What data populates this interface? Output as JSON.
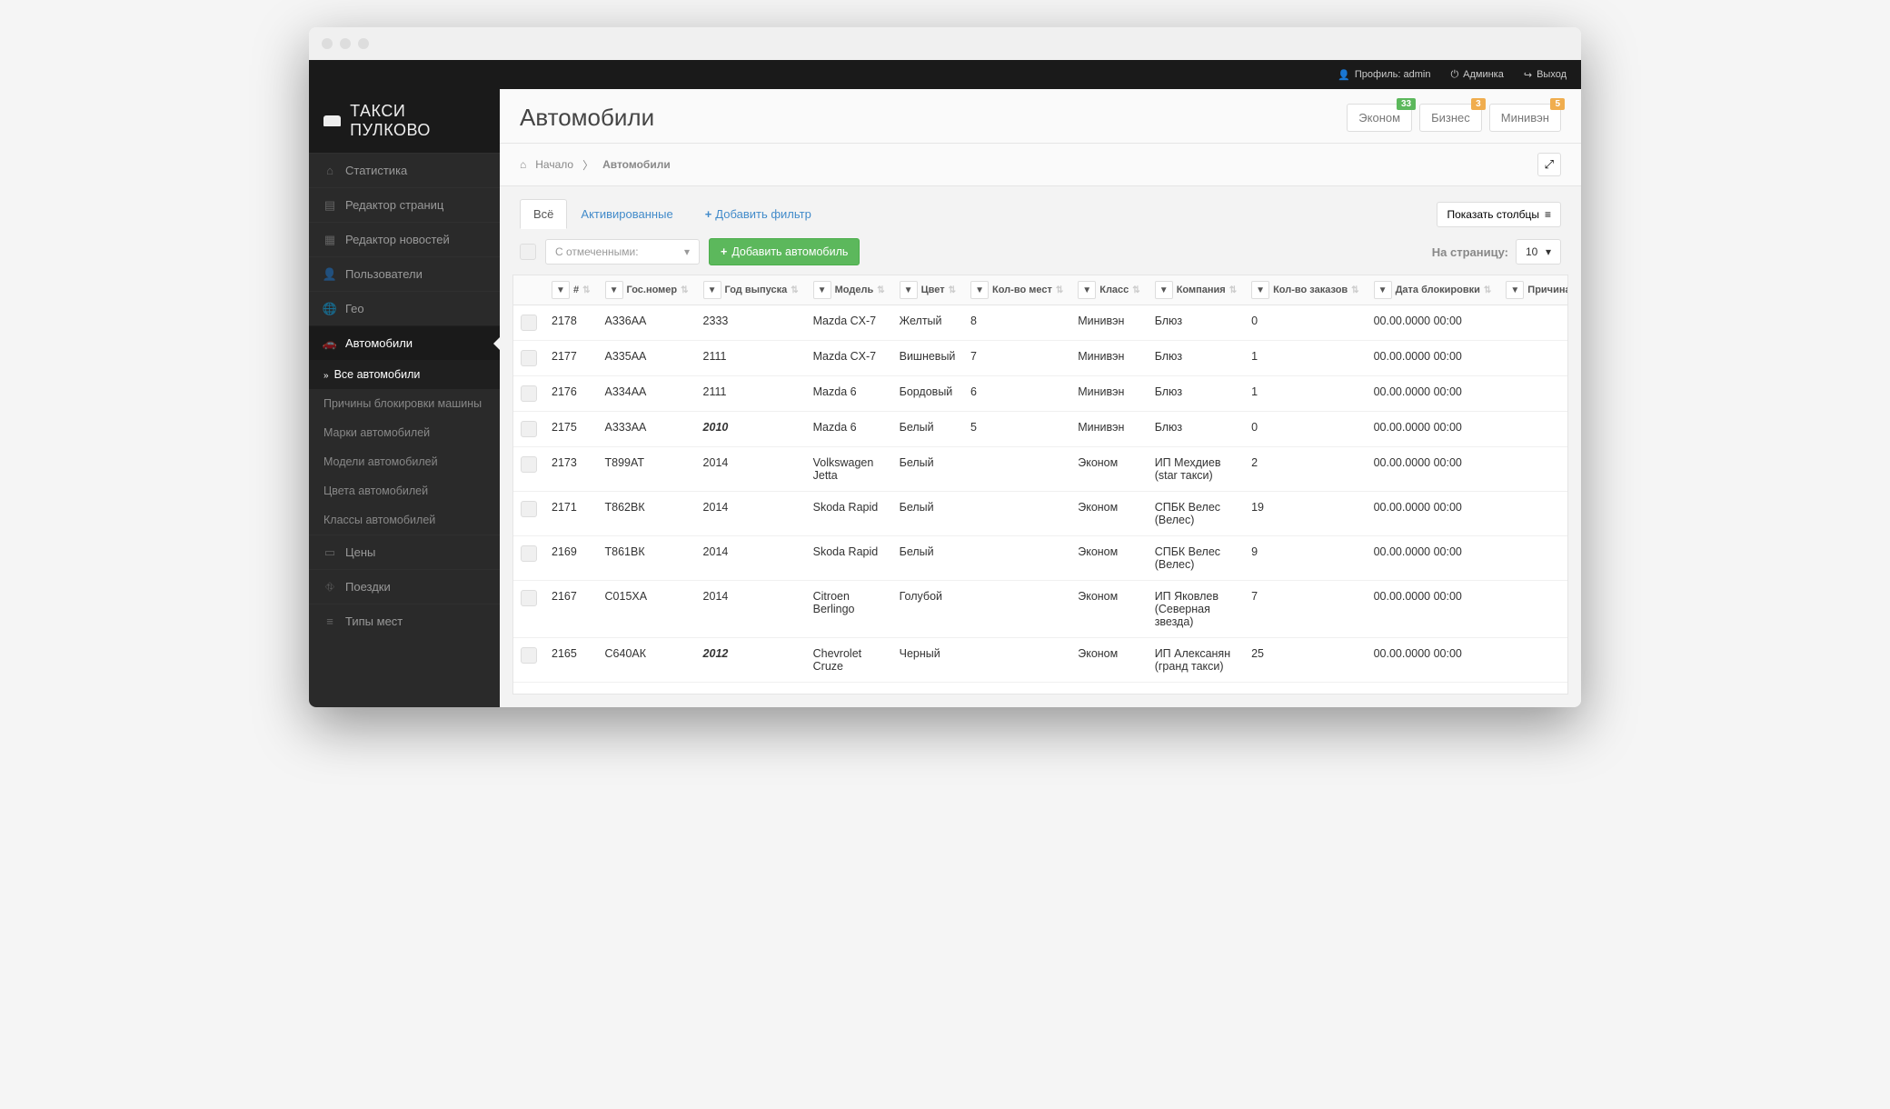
{
  "topbar": {
    "profile": "Профиль: admin",
    "admin": "Админка",
    "logout": "Выход"
  },
  "brand": "ТАКСИ ПУЛКОВО",
  "sidebar": {
    "items": [
      {
        "label": "Статистика"
      },
      {
        "label": "Редактор страниц"
      },
      {
        "label": "Редактор новостей"
      },
      {
        "label": "Пользователи"
      },
      {
        "label": "Гео"
      },
      {
        "label": "Автомобили"
      },
      {
        "label": "Цены"
      },
      {
        "label": "Поездки"
      },
      {
        "label": "Типы мест"
      }
    ],
    "sub": [
      {
        "label": "Все автомобили"
      },
      {
        "label": "Причины блокировки машины"
      },
      {
        "label": "Марки автомобилей"
      },
      {
        "label": "Модели автомобилей"
      },
      {
        "label": "Цвета автомобилей"
      },
      {
        "label": "Классы автомобилей"
      }
    ]
  },
  "header": {
    "title": "Автомобили",
    "badges": [
      {
        "label": "Эконом",
        "count": "33",
        "color": "green"
      },
      {
        "label": "Бизнес",
        "count": "3",
        "color": "orange"
      },
      {
        "label": "Минивэн",
        "count": "5",
        "color": "orange"
      }
    ]
  },
  "breadcrumb": {
    "home": "Начало",
    "current": "Автомобили"
  },
  "tabs": {
    "all": "Всё",
    "activated": "Активированные"
  },
  "add_filter": "Добавить фильтр",
  "show_columns": "Показать столбцы",
  "bulk_placeholder": "С отмеченными:",
  "add_car": "Добавить автомобиль",
  "per_page_label": "На страницу:",
  "per_page_value": "10",
  "columns": [
    "#",
    "Гос.номер",
    "Год выпуска",
    "Модель",
    "Цвет",
    "Кол-во мест",
    "Класс",
    "Компания",
    "Кол-во заказов",
    "Дата блокировки",
    "Причина блокировки"
  ],
  "rows": [
    {
      "id": "2178",
      "plate": "А336АА",
      "year": "2333",
      "model": "Mazda CX-7",
      "color": "Желтый",
      "seats": "8",
      "class": "Минивэн",
      "company": "Блюз",
      "orders": "0",
      "blocked": "00.00.0000 00:00",
      "reason": ""
    },
    {
      "id": "2177",
      "plate": "А335АА",
      "year": "2111",
      "model": "Mazda CX-7",
      "color": "Вишневый",
      "seats": "7",
      "class": "Минивэн",
      "company": "Блюз",
      "orders": "1",
      "blocked": "00.00.0000 00:00",
      "reason": ""
    },
    {
      "id": "2176",
      "plate": "А334АА",
      "year": "2111",
      "model": "Mazda 6",
      "color": "Бордовый",
      "seats": "6",
      "class": "Минивэн",
      "company": "Блюз",
      "orders": "1",
      "blocked": "00.00.0000 00:00",
      "reason": ""
    },
    {
      "id": "2175",
      "plate": "А333АА",
      "year": "2010",
      "year_em": true,
      "model": "Mazda 6",
      "color": "Белый",
      "seats": "5",
      "class": "Минивэн",
      "company": "Блюз",
      "orders": "0",
      "blocked": "00.00.0000 00:00",
      "reason": ""
    },
    {
      "id": "2173",
      "plate": "Т899АТ",
      "year": "2014",
      "model": "Volkswagen Jetta",
      "color": "Белый",
      "seats": "",
      "class": "Эконом",
      "company": "ИП Мехдиев (star такси)",
      "orders": "2",
      "blocked": "00.00.0000 00:00",
      "reason": ""
    },
    {
      "id": "2171",
      "plate": "Т862ВК",
      "year": "2014",
      "model": "Skoda Rapid",
      "color": "Белый",
      "seats": "",
      "class": "Эконом",
      "company": "СПБК Велес (Велес)",
      "orders": "19",
      "blocked": "00.00.0000 00:00",
      "reason": ""
    },
    {
      "id": "2169",
      "plate": "Т861ВК",
      "year": "2014",
      "model": "Skoda Rapid",
      "color": "Белый",
      "seats": "",
      "class": "Эконом",
      "company": "СПБК Велес (Велес)",
      "orders": "9",
      "blocked": "00.00.0000 00:00",
      "reason": ""
    },
    {
      "id": "2167",
      "plate": "С015ХА",
      "year": "2014",
      "model": "Citroen Berlingo",
      "color": "Голубой",
      "seats": "",
      "class": "Эконом",
      "company": "ИП Яковлев (Северная звезда)",
      "orders": "7",
      "blocked": "00.00.0000 00:00",
      "reason": ""
    },
    {
      "id": "2165",
      "plate": "С640АК",
      "year": "2012",
      "year_em": true,
      "model": "Chevrolet Cruze",
      "color": "Черный",
      "seats": "",
      "class": "Эконом",
      "company": "ИП Алексанян (гранд такси)",
      "orders": "25",
      "blocked": "00.00.0000 00:00",
      "reason": ""
    }
  ]
}
